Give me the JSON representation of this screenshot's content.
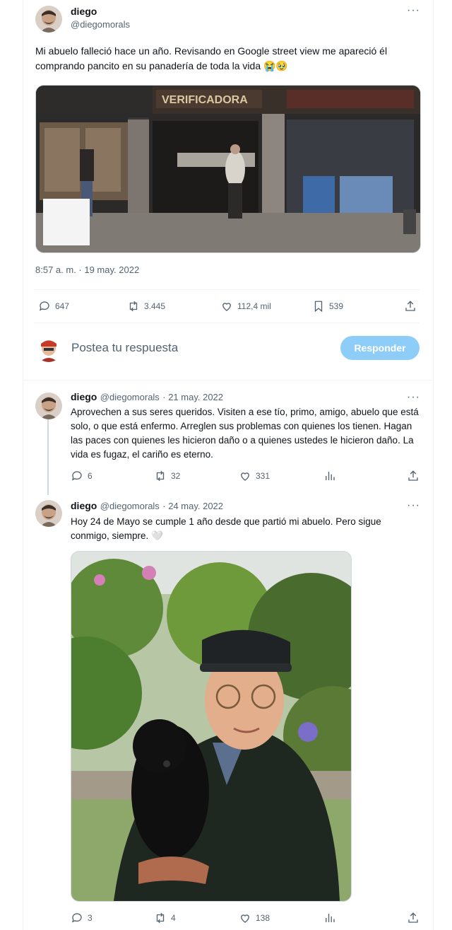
{
  "main_tweet": {
    "author_name": "diego",
    "author_handle": "@diegomorals",
    "text": "Mi abuelo falleció hace un año. Revisando en Google street view me apareció él comprando pancito en su panadería de toda la vida 😭🥹",
    "timestamp": "8:57 a. m. · 19 may. 2022",
    "stats": {
      "replies": "647",
      "reposts": "3.445",
      "likes": "112,4 mil",
      "bookmarks": "539"
    },
    "streetview_sign": "VERIFICADORA"
  },
  "composer": {
    "placeholder": "Postea tu respuesta",
    "reply_button": "Responder"
  },
  "replies": [
    {
      "author_name": "diego",
      "author_handle": "@diegomorals",
      "date": "· 21 may. 2022",
      "text": "Aprovechen a sus seres queridos. Visiten a ese tío, primo, amigo, abuelo que está solo, o que está enfermo. Arreglen sus problemas con quienes los tienen. Hagan las paces con quienes les hicieron daño o a quienes ustedes le hicieron daño. La vida es fugaz, el cariño es eterno.",
      "stats": {
        "replies": "6",
        "reposts": "32",
        "likes": "331"
      }
    },
    {
      "author_name": "diego",
      "author_handle": "@diegomorals",
      "date": "· 24 may. 2022",
      "text": "Hoy 24 de Mayo se cumple 1 año desde que partió mi abuelo. Pero sigue conmigo, siempre. 🤍",
      "stats": {
        "replies": "3",
        "reposts": "4",
        "likes": "138"
      }
    }
  ],
  "colors": {
    "accent": "#1d9bf0",
    "button_disabled": "#8ecdf8",
    "secondary_text": "#536471",
    "border": "#eff3f4"
  },
  "icons": [
    "more-icon",
    "reply-icon",
    "repost-icon",
    "like-icon",
    "bookmark-icon",
    "share-icon",
    "views-icon"
  ]
}
